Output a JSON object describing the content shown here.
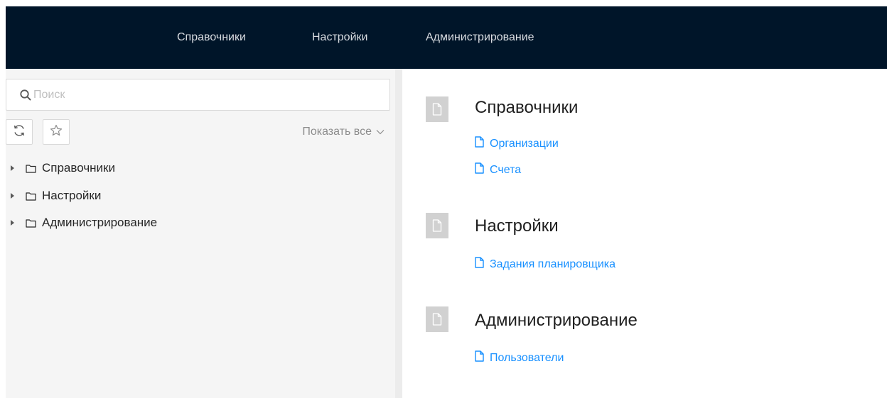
{
  "topnav": {
    "items": [
      "Справочники",
      "Настройки",
      "Администрирование"
    ]
  },
  "sidebar": {
    "search": {
      "placeholder": "Поиск",
      "value": ""
    },
    "toolbar": {
      "show_all": "Показать все"
    },
    "tree": [
      {
        "label": "Справочники"
      },
      {
        "label": "Настройки"
      },
      {
        "label": "Администрирование"
      }
    ]
  },
  "content": {
    "sections": [
      {
        "title": "Справочники",
        "links": [
          "Организации",
          "Счета"
        ]
      },
      {
        "title": "Настройки",
        "links": [
          "Задания планировщика"
        ]
      },
      {
        "title": "Администрирование",
        "links": [
          "Пользователи"
        ]
      }
    ]
  },
  "colors": {
    "nav_bg": "#001529",
    "link": "#1890ff",
    "sider_bg": "#f5f5f5"
  }
}
